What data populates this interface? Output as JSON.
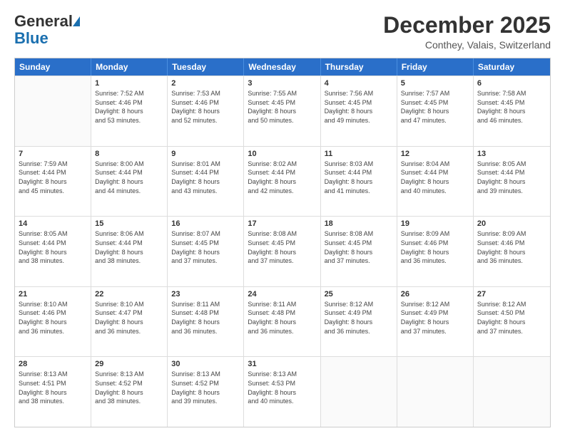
{
  "header": {
    "logo_general": "General",
    "logo_blue": "Blue",
    "month": "December 2025",
    "location": "Conthey, Valais, Switzerland"
  },
  "days": [
    "Sunday",
    "Monday",
    "Tuesday",
    "Wednesday",
    "Thursday",
    "Friday",
    "Saturday"
  ],
  "weeks": [
    [
      {
        "num": "",
        "lines": []
      },
      {
        "num": "1",
        "lines": [
          "Sunrise: 7:52 AM",
          "Sunset: 4:46 PM",
          "Daylight: 8 hours",
          "and 53 minutes."
        ]
      },
      {
        "num": "2",
        "lines": [
          "Sunrise: 7:53 AM",
          "Sunset: 4:46 PM",
          "Daylight: 8 hours",
          "and 52 minutes."
        ]
      },
      {
        "num": "3",
        "lines": [
          "Sunrise: 7:55 AM",
          "Sunset: 4:45 PM",
          "Daylight: 8 hours",
          "and 50 minutes."
        ]
      },
      {
        "num": "4",
        "lines": [
          "Sunrise: 7:56 AM",
          "Sunset: 4:45 PM",
          "Daylight: 8 hours",
          "and 49 minutes."
        ]
      },
      {
        "num": "5",
        "lines": [
          "Sunrise: 7:57 AM",
          "Sunset: 4:45 PM",
          "Daylight: 8 hours",
          "and 47 minutes."
        ]
      },
      {
        "num": "6",
        "lines": [
          "Sunrise: 7:58 AM",
          "Sunset: 4:45 PM",
          "Daylight: 8 hours",
          "and 46 minutes."
        ]
      }
    ],
    [
      {
        "num": "7",
        "lines": [
          "Sunrise: 7:59 AM",
          "Sunset: 4:44 PM",
          "Daylight: 8 hours",
          "and 45 minutes."
        ]
      },
      {
        "num": "8",
        "lines": [
          "Sunrise: 8:00 AM",
          "Sunset: 4:44 PM",
          "Daylight: 8 hours",
          "and 44 minutes."
        ]
      },
      {
        "num": "9",
        "lines": [
          "Sunrise: 8:01 AM",
          "Sunset: 4:44 PM",
          "Daylight: 8 hours",
          "and 43 minutes."
        ]
      },
      {
        "num": "10",
        "lines": [
          "Sunrise: 8:02 AM",
          "Sunset: 4:44 PM",
          "Daylight: 8 hours",
          "and 42 minutes."
        ]
      },
      {
        "num": "11",
        "lines": [
          "Sunrise: 8:03 AM",
          "Sunset: 4:44 PM",
          "Daylight: 8 hours",
          "and 41 minutes."
        ]
      },
      {
        "num": "12",
        "lines": [
          "Sunrise: 8:04 AM",
          "Sunset: 4:44 PM",
          "Daylight: 8 hours",
          "and 40 minutes."
        ]
      },
      {
        "num": "13",
        "lines": [
          "Sunrise: 8:05 AM",
          "Sunset: 4:44 PM",
          "Daylight: 8 hours",
          "and 39 minutes."
        ]
      }
    ],
    [
      {
        "num": "14",
        "lines": [
          "Sunrise: 8:05 AM",
          "Sunset: 4:44 PM",
          "Daylight: 8 hours",
          "and 38 minutes."
        ]
      },
      {
        "num": "15",
        "lines": [
          "Sunrise: 8:06 AM",
          "Sunset: 4:44 PM",
          "Daylight: 8 hours",
          "and 38 minutes."
        ]
      },
      {
        "num": "16",
        "lines": [
          "Sunrise: 8:07 AM",
          "Sunset: 4:45 PM",
          "Daylight: 8 hours",
          "and 37 minutes."
        ]
      },
      {
        "num": "17",
        "lines": [
          "Sunrise: 8:08 AM",
          "Sunset: 4:45 PM",
          "Daylight: 8 hours",
          "and 37 minutes."
        ]
      },
      {
        "num": "18",
        "lines": [
          "Sunrise: 8:08 AM",
          "Sunset: 4:45 PM",
          "Daylight: 8 hours",
          "and 37 minutes."
        ]
      },
      {
        "num": "19",
        "lines": [
          "Sunrise: 8:09 AM",
          "Sunset: 4:46 PM",
          "Daylight: 8 hours",
          "and 36 minutes."
        ]
      },
      {
        "num": "20",
        "lines": [
          "Sunrise: 8:09 AM",
          "Sunset: 4:46 PM",
          "Daylight: 8 hours",
          "and 36 minutes."
        ]
      }
    ],
    [
      {
        "num": "21",
        "lines": [
          "Sunrise: 8:10 AM",
          "Sunset: 4:46 PM",
          "Daylight: 8 hours",
          "and 36 minutes."
        ]
      },
      {
        "num": "22",
        "lines": [
          "Sunrise: 8:10 AM",
          "Sunset: 4:47 PM",
          "Daylight: 8 hours",
          "and 36 minutes."
        ]
      },
      {
        "num": "23",
        "lines": [
          "Sunrise: 8:11 AM",
          "Sunset: 4:48 PM",
          "Daylight: 8 hours",
          "and 36 minutes."
        ]
      },
      {
        "num": "24",
        "lines": [
          "Sunrise: 8:11 AM",
          "Sunset: 4:48 PM",
          "Daylight: 8 hours",
          "and 36 minutes."
        ]
      },
      {
        "num": "25",
        "lines": [
          "Sunrise: 8:12 AM",
          "Sunset: 4:49 PM",
          "Daylight: 8 hours",
          "and 36 minutes."
        ]
      },
      {
        "num": "26",
        "lines": [
          "Sunrise: 8:12 AM",
          "Sunset: 4:49 PM",
          "Daylight: 8 hours",
          "and 37 minutes."
        ]
      },
      {
        "num": "27",
        "lines": [
          "Sunrise: 8:12 AM",
          "Sunset: 4:50 PM",
          "Daylight: 8 hours",
          "and 37 minutes."
        ]
      }
    ],
    [
      {
        "num": "28",
        "lines": [
          "Sunrise: 8:13 AM",
          "Sunset: 4:51 PM",
          "Daylight: 8 hours",
          "and 38 minutes."
        ]
      },
      {
        "num": "29",
        "lines": [
          "Sunrise: 8:13 AM",
          "Sunset: 4:52 PM",
          "Daylight: 8 hours",
          "and 38 minutes."
        ]
      },
      {
        "num": "30",
        "lines": [
          "Sunrise: 8:13 AM",
          "Sunset: 4:52 PM",
          "Daylight: 8 hours",
          "and 39 minutes."
        ]
      },
      {
        "num": "31",
        "lines": [
          "Sunrise: 8:13 AM",
          "Sunset: 4:53 PM",
          "Daylight: 8 hours",
          "and 40 minutes."
        ]
      },
      {
        "num": "",
        "lines": []
      },
      {
        "num": "",
        "lines": []
      },
      {
        "num": "",
        "lines": []
      }
    ]
  ]
}
